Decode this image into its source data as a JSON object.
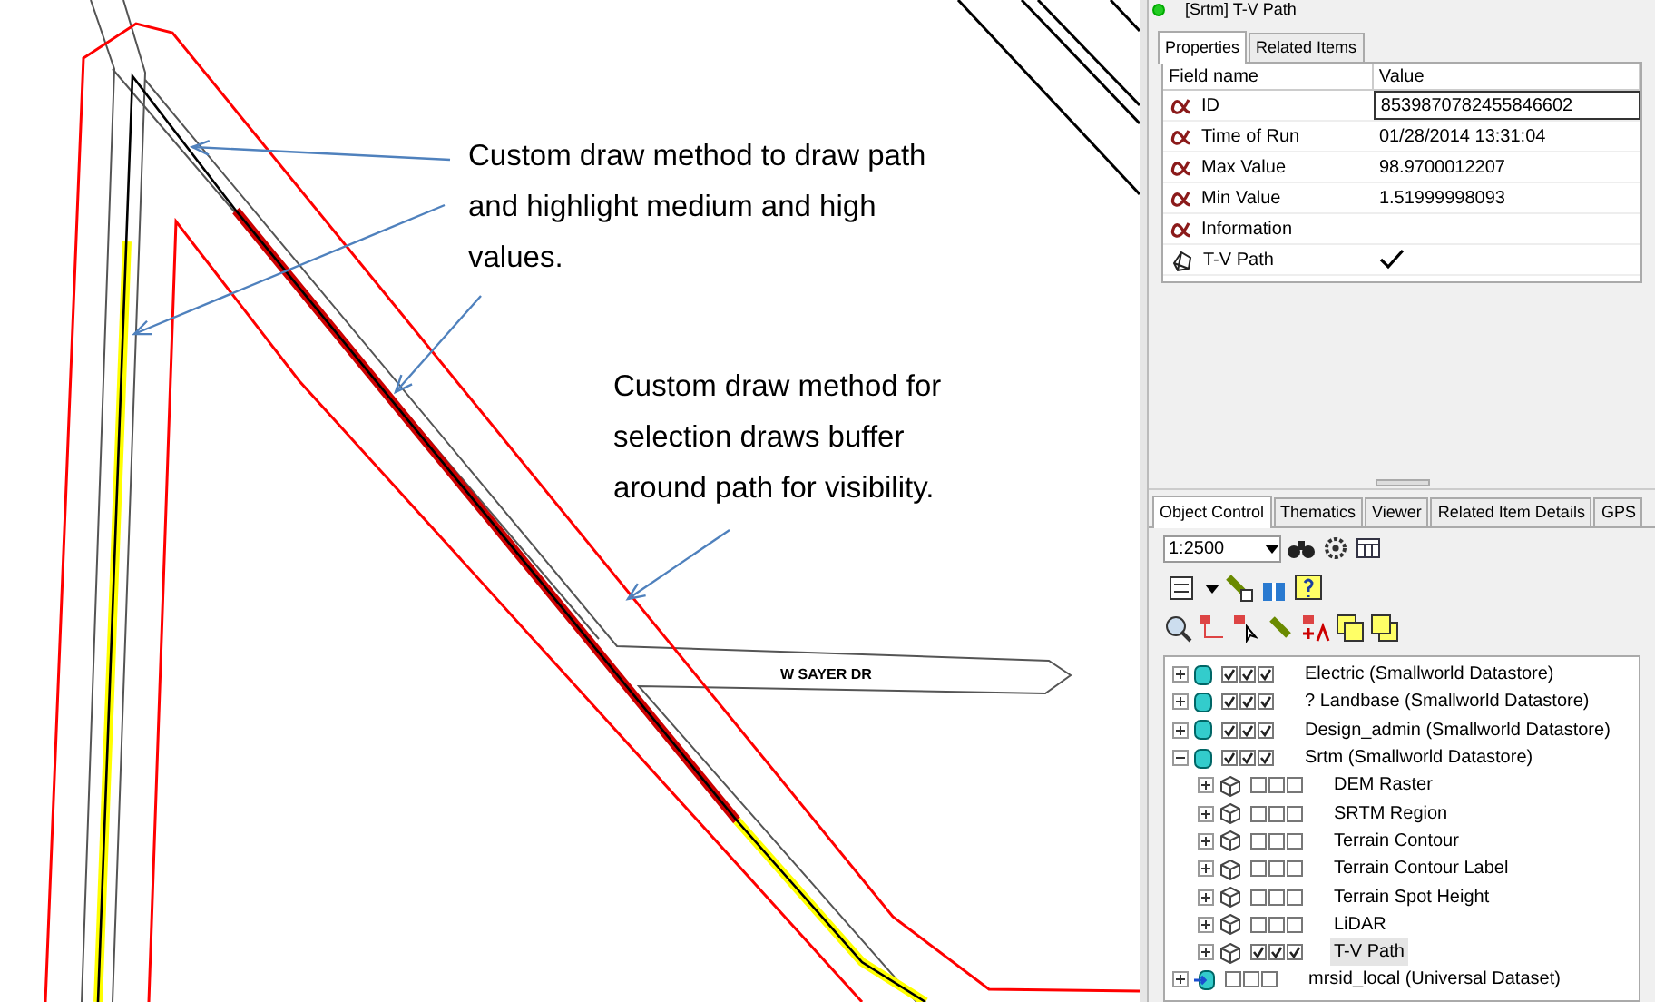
{
  "map": {
    "road_label": "W SAYER DR",
    "callouts": [
      {
        "text": "Custom draw method to draw path and highlight medium and high values."
      },
      {
        "text": "Custom draw method for selection draws buffer around path for visibility."
      }
    ]
  },
  "object_panel": {
    "title": "[Srtm] T-V Path",
    "tabs": [
      {
        "label": "Properties",
        "selected": true
      },
      {
        "label": "Related Items",
        "selected": false
      }
    ],
    "columns": [
      "Field name",
      "Value"
    ],
    "rows": [
      {
        "kind": "text",
        "field": "ID",
        "value": "8539870782455846602",
        "selected": true
      },
      {
        "kind": "text",
        "field": "Time of Run",
        "value": "01/28/2014 13:31:04",
        "selected": false
      },
      {
        "kind": "text",
        "field": "Max Value",
        "value": "98.9700012207",
        "selected": false
      },
      {
        "kind": "text",
        "field": "Min Value",
        "value": "1.51999998093",
        "selected": false
      },
      {
        "kind": "text",
        "field": "Information",
        "value": "",
        "selected": false
      },
      {
        "kind": "geometry",
        "field": "T-V Path",
        "checked": true,
        "selected": false
      }
    ]
  },
  "control_panel": {
    "tabs": [
      {
        "label": "Object Control",
        "selected": true
      },
      {
        "label": "Thematics",
        "selected": false
      },
      {
        "label": "Viewer",
        "selected": false
      },
      {
        "label": "Related Item Details",
        "selected": false
      },
      {
        "label": "GPS",
        "selected": false
      }
    ],
    "scale": "1:2500",
    "layers": [
      {
        "kind": "datastore",
        "name": "Electric (Smallworld Datastore)",
        "expanded": false,
        "selected": false,
        "checks": [
          true,
          true,
          true
        ]
      },
      {
        "kind": "datastore",
        "name": "? Landbase (Smallworld Datastore)",
        "expanded": false,
        "selected": false,
        "checks": [
          true,
          true,
          true
        ]
      },
      {
        "kind": "datastore",
        "name": "Design_admin (Smallworld Datastore)",
        "expanded": false,
        "selected": false,
        "checks": [
          true,
          true,
          true
        ]
      },
      {
        "kind": "datastore",
        "name": "Srtm (Smallworld Datastore)",
        "expanded": true,
        "selected": false,
        "checks": [
          true,
          true,
          true
        ],
        "children": [
          {
            "kind": "layer",
            "name": "DEM Raster",
            "expanded": false,
            "selected": false,
            "checks": [
              false,
              false,
              false
            ]
          },
          {
            "kind": "layer",
            "name": "SRTM Region",
            "expanded": false,
            "selected": false,
            "checks": [
              false,
              false,
              false
            ]
          },
          {
            "kind": "layer",
            "name": "Terrain Contour",
            "expanded": false,
            "selected": false,
            "checks": [
              false,
              false,
              false
            ]
          },
          {
            "kind": "layer",
            "name": "Terrain Contour Label",
            "expanded": false,
            "selected": false,
            "checks": [
              false,
              false,
              false
            ]
          },
          {
            "kind": "layer",
            "name": "Terrain Spot Height",
            "expanded": false,
            "selected": false,
            "checks": [
              false,
              false,
              false
            ]
          },
          {
            "kind": "layer",
            "name": "LiDAR",
            "expanded": false,
            "selected": false,
            "checks": [
              false,
              false,
              false
            ]
          },
          {
            "kind": "layer",
            "name": "T-V Path",
            "expanded": false,
            "selected": true,
            "checks": [
              true,
              true,
              true
            ]
          }
        ]
      },
      {
        "kind": "dataset",
        "name": "mrsid_local (Universal Dataset)",
        "expanded": false,
        "selected": false,
        "checks": [
          false,
          false,
          false
        ]
      }
    ]
  }
}
